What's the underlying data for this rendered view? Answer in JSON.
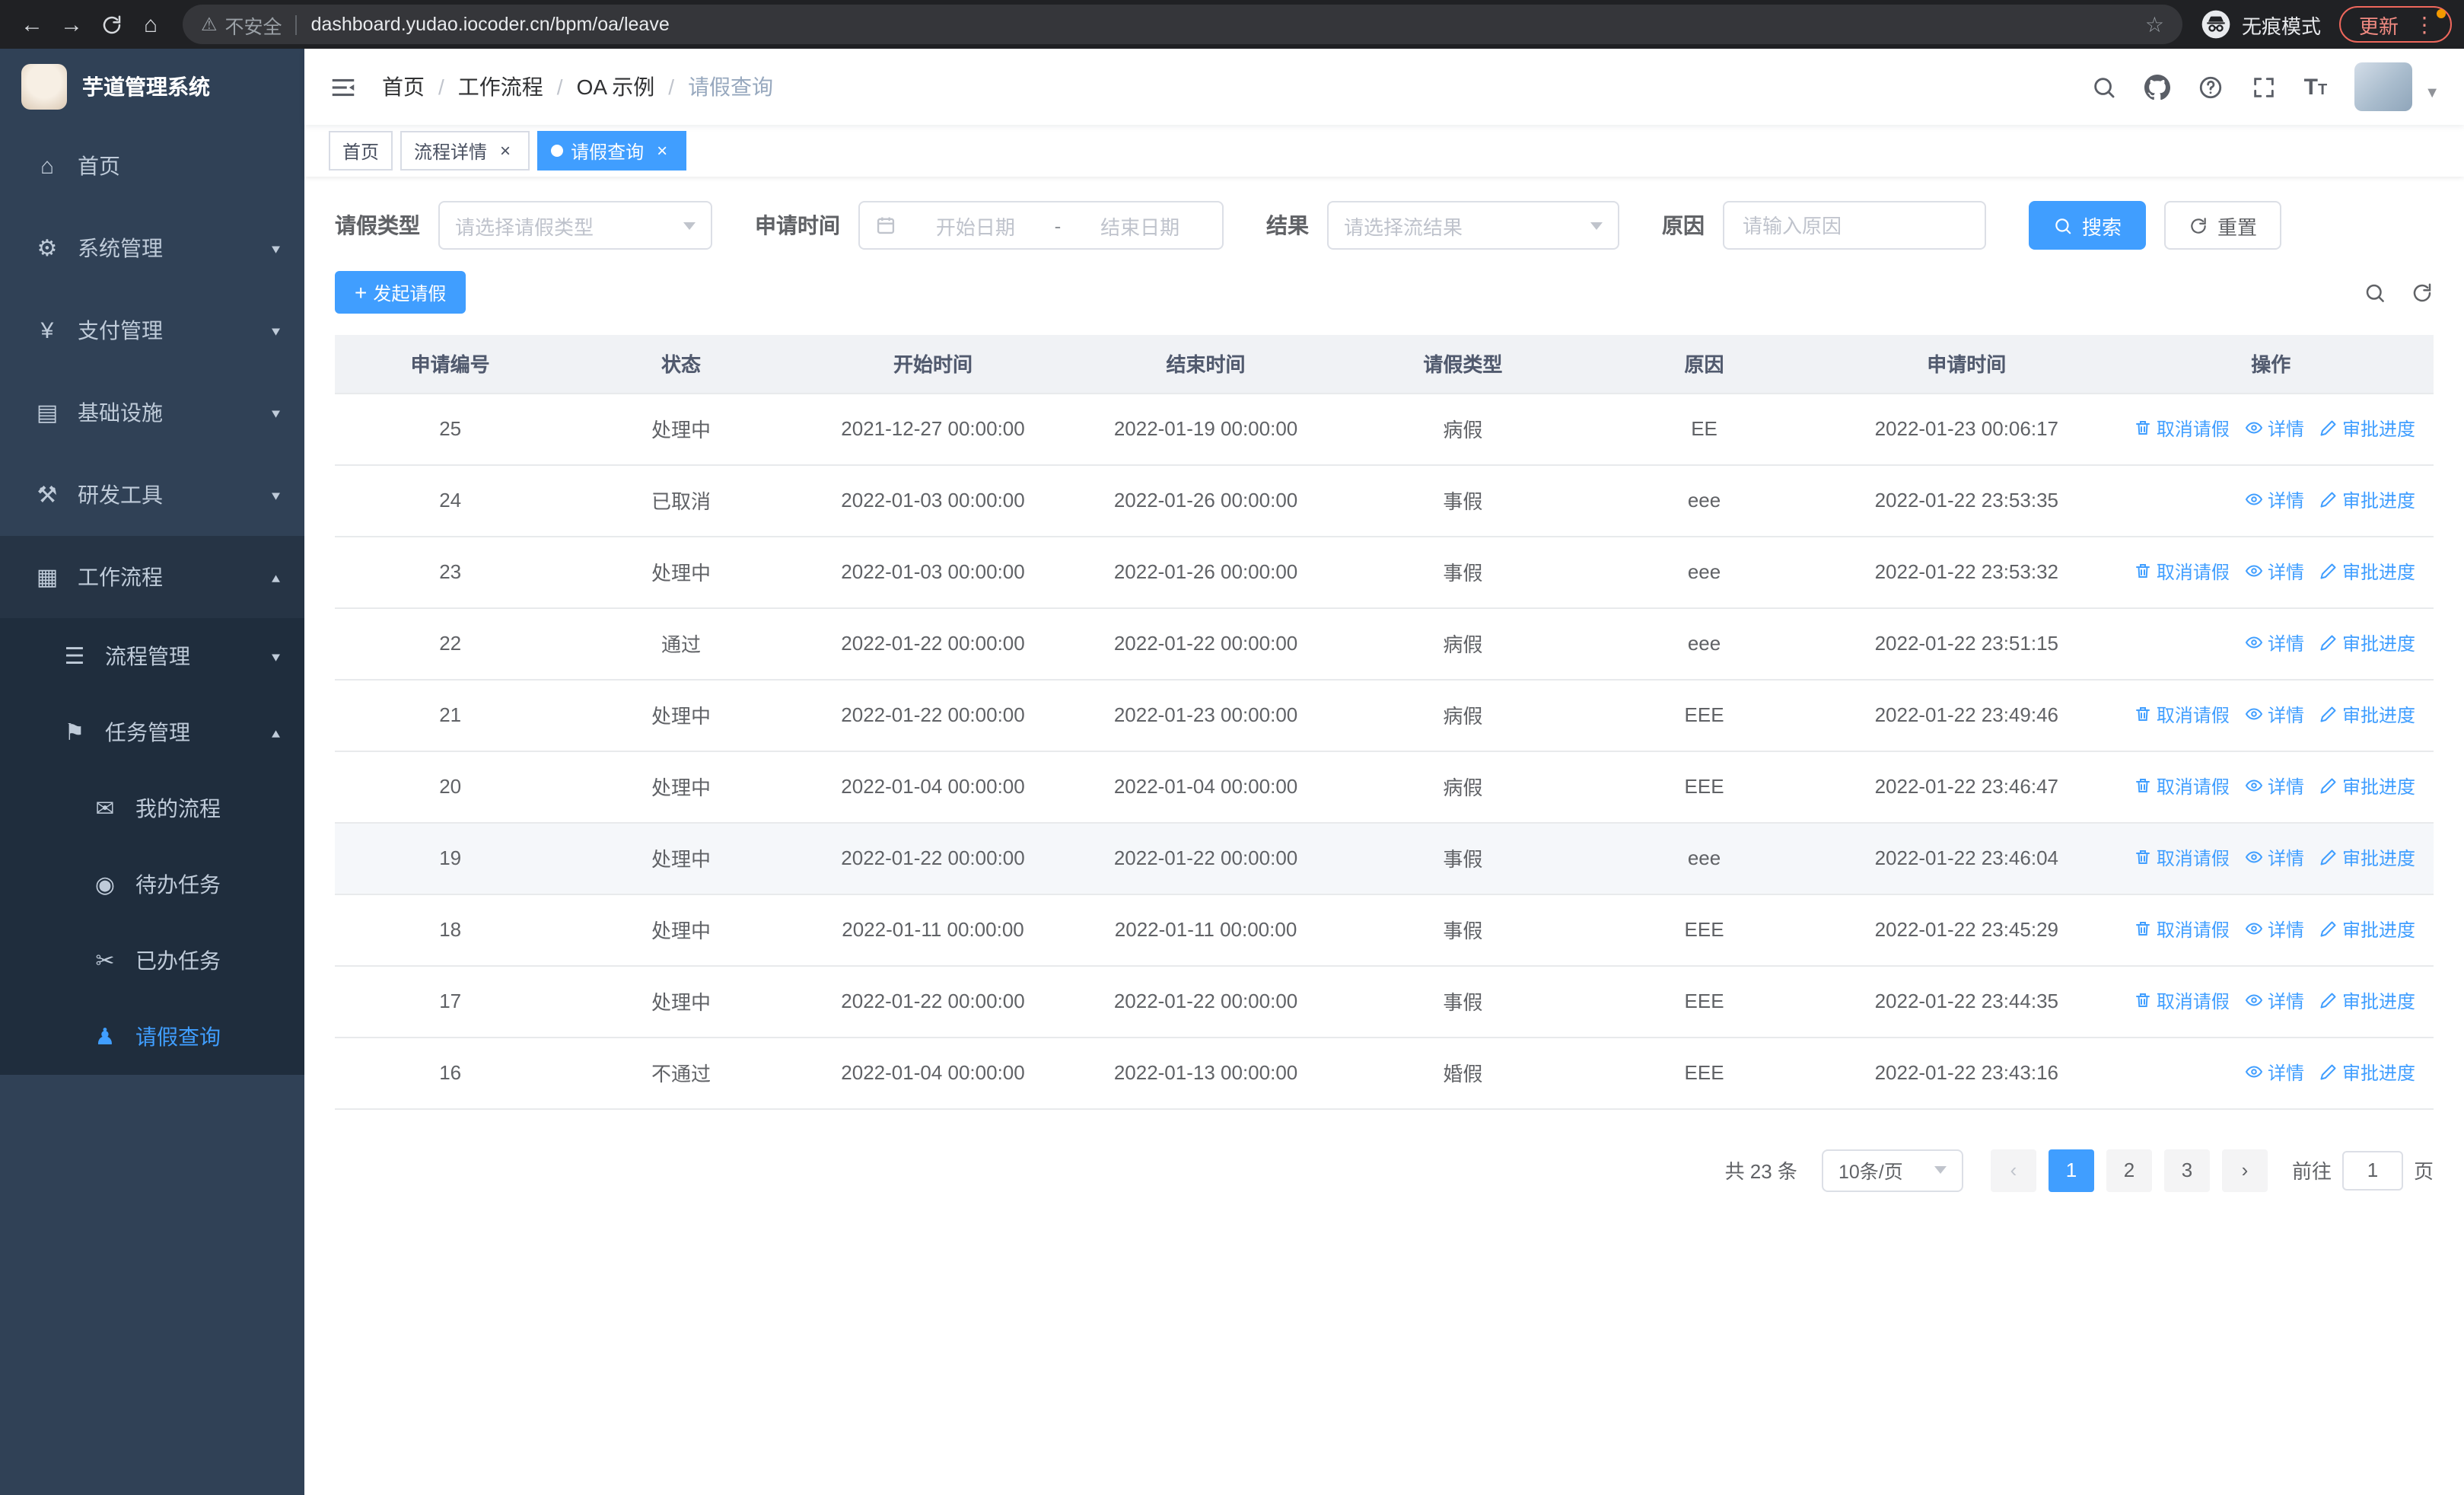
{
  "colors": {
    "accent": "#409eff",
    "sidebar_bg": "#304156",
    "submenu_bg": "#1f2d3d"
  },
  "browser": {
    "security_label": "不安全",
    "url": "dashboard.yudao.iocoder.cn/bpm/oa/leave",
    "incognito_label": "无痕模式",
    "update_label": "更新"
  },
  "sidebar": {
    "app_title": "芋道管理系统",
    "menu": [
      {
        "name": "sidebar-item-home",
        "label": "首页",
        "icon": "home-icon",
        "depth": 0
      },
      {
        "name": "sidebar-item-system-mgmt",
        "label": "系统管理",
        "icon": "gear-icon",
        "depth": 0,
        "arrow": "down"
      },
      {
        "name": "sidebar-item-payment-mgmt",
        "label": "支付管理",
        "icon": "yen-icon",
        "depth": 0,
        "arrow": "down"
      },
      {
        "name": "sidebar-item-infrastructure",
        "label": "基础设施",
        "icon": "infrastructure-icon",
        "depth": 0,
        "arrow": "down"
      },
      {
        "name": "sidebar-item-dev-tools",
        "label": "研发工具",
        "icon": "tools-icon",
        "depth": 0,
        "arrow": "down"
      },
      {
        "name": "sidebar-item-workflow",
        "label": "工作流程",
        "icon": "workflow-icon",
        "depth": 0,
        "arrow": "up",
        "open": true
      },
      {
        "name": "sidebar-item-process-mgmt",
        "label": "流程管理",
        "icon": "process-icon",
        "depth": 1,
        "arrow": "down",
        "sub": true
      },
      {
        "name": "sidebar-item-task-mgmt",
        "label": "任务管理",
        "icon": "task-icon",
        "depth": 1,
        "arrow": "up",
        "open": true,
        "sub": true
      },
      {
        "name": "sidebar-item-my-process",
        "label": "我的流程",
        "icon": "chat-icon",
        "depth": 2,
        "sub": true
      },
      {
        "name": "sidebar-item-todo-tasks",
        "label": "待办任务",
        "icon": "eye-icon",
        "depth": 2,
        "sub": true
      },
      {
        "name": "sidebar-item-done-tasks",
        "label": "已办任务",
        "icon": "done-icon",
        "depth": 2,
        "sub": true
      },
      {
        "name": "sidebar-item-leave-query",
        "label": "请假查询",
        "icon": "user-icon",
        "depth": 2,
        "sub": true,
        "active": true
      }
    ]
  },
  "icon_glyphs": {
    "home-icon": "⌂",
    "gear-icon": "⚙",
    "yen-icon": "¥",
    "infrastructure-icon": "▤",
    "tools-icon": "⚒",
    "workflow-icon": "▦",
    "process-icon": "☰",
    "task-icon": "⚑",
    "chat-icon": "✉",
    "eye-icon": "◉",
    "done-icon": "✂",
    "user-icon": "♟"
  },
  "breadcrumb": [
    "首页",
    "工作流程",
    "OA 示例",
    "请假查询"
  ],
  "tabs": [
    {
      "name": "tab-home",
      "label": "首页",
      "closable": false,
      "active": false
    },
    {
      "name": "tab-process-detail",
      "label": "流程详情",
      "closable": true,
      "active": false
    },
    {
      "name": "tab-leave-query",
      "label": "请假查询",
      "closable": true,
      "active": true
    }
  ],
  "filters": {
    "leave_type_label": "请假类型",
    "leave_type_placeholder": "请选择请假类型",
    "apply_time_label": "申请时间",
    "start_date_placeholder": "开始日期",
    "range_separator": "-",
    "end_date_placeholder": "结束日期",
    "result_label": "结果",
    "result_placeholder": "请选择流结果",
    "reason_label": "原因",
    "reason_placeholder": "请输入原因",
    "search_label": "搜索",
    "reset_label": "重置"
  },
  "toolbar": {
    "create_label": "发起请假"
  },
  "table": {
    "columns": [
      "申请编号",
      "状态",
      "开始时间",
      "结束时间",
      "请假类型",
      "原因",
      "申请时间",
      "操作"
    ],
    "op_labels": {
      "cancel": "取消请假",
      "detail": "详情",
      "progress": "审批进度"
    },
    "rows": [
      {
        "id": "25",
        "status": "处理中",
        "start": "2021-12-27 00:00:00",
        "end": "2022-01-19 00:00:00",
        "type": "病假",
        "reason": "EE",
        "apply_time": "2022-01-23 00:06:17",
        "ops": [
          "cancel",
          "detail",
          "progress"
        ],
        "highlight": false
      },
      {
        "id": "24",
        "status": "已取消",
        "start": "2022-01-03 00:00:00",
        "end": "2022-01-26 00:00:00",
        "type": "事假",
        "reason": "eee",
        "apply_time": "2022-01-22 23:53:35",
        "ops": [
          "detail",
          "progress"
        ],
        "highlight": false
      },
      {
        "id": "23",
        "status": "处理中",
        "start": "2022-01-03 00:00:00",
        "end": "2022-01-26 00:00:00",
        "type": "事假",
        "reason": "eee",
        "apply_time": "2022-01-22 23:53:32",
        "ops": [
          "cancel",
          "detail",
          "progress"
        ],
        "highlight": false
      },
      {
        "id": "22",
        "status": "通过",
        "start": "2022-01-22 00:00:00",
        "end": "2022-01-22 00:00:00",
        "type": "病假",
        "reason": "eee",
        "apply_time": "2022-01-22 23:51:15",
        "ops": [
          "detail",
          "progress"
        ],
        "highlight": false
      },
      {
        "id": "21",
        "status": "处理中",
        "start": "2022-01-22 00:00:00",
        "end": "2022-01-23 00:00:00",
        "type": "病假",
        "reason": "EEE",
        "apply_time": "2022-01-22 23:49:46",
        "ops": [
          "cancel",
          "detail",
          "progress"
        ],
        "highlight": false
      },
      {
        "id": "20",
        "status": "处理中",
        "start": "2022-01-04 00:00:00",
        "end": "2022-01-04 00:00:00",
        "type": "病假",
        "reason": "EEE",
        "apply_time": "2022-01-22 23:46:47",
        "ops": [
          "cancel",
          "detail",
          "progress"
        ],
        "highlight": false
      },
      {
        "id": "19",
        "status": "处理中",
        "start": "2022-01-22 00:00:00",
        "end": "2022-01-22 00:00:00",
        "type": "事假",
        "reason": "eee",
        "apply_time": "2022-01-22 23:46:04",
        "ops": [
          "cancel",
          "detail",
          "progress"
        ],
        "highlight": true
      },
      {
        "id": "18",
        "status": "处理中",
        "start": "2022-01-11 00:00:00",
        "end": "2022-01-11 00:00:00",
        "type": "事假",
        "reason": "EEE",
        "apply_time": "2022-01-22 23:45:29",
        "ops": [
          "cancel",
          "detail",
          "progress"
        ],
        "highlight": false
      },
      {
        "id": "17",
        "status": "处理中",
        "start": "2022-01-22 00:00:00",
        "end": "2022-01-22 00:00:00",
        "type": "事假",
        "reason": "EEE",
        "apply_time": "2022-01-22 23:44:35",
        "ops": [
          "cancel",
          "detail",
          "progress"
        ],
        "highlight": false
      },
      {
        "id": "16",
        "status": "不通过",
        "start": "2022-01-04 00:00:00",
        "end": "2022-01-13 00:00:00",
        "type": "婚假",
        "reason": "EEE",
        "apply_time": "2022-01-22 23:43:16",
        "ops": [
          "detail",
          "progress"
        ],
        "highlight": false
      }
    ]
  },
  "pagination": {
    "total": "共 23 条",
    "page_size": "10条/页",
    "pages": [
      "1",
      "2",
      "3"
    ],
    "active_page": "1",
    "prev_enabled": false,
    "next_enabled": true,
    "goto_prefix": "前往",
    "goto_value": "1",
    "goto_suffix": "页"
  }
}
